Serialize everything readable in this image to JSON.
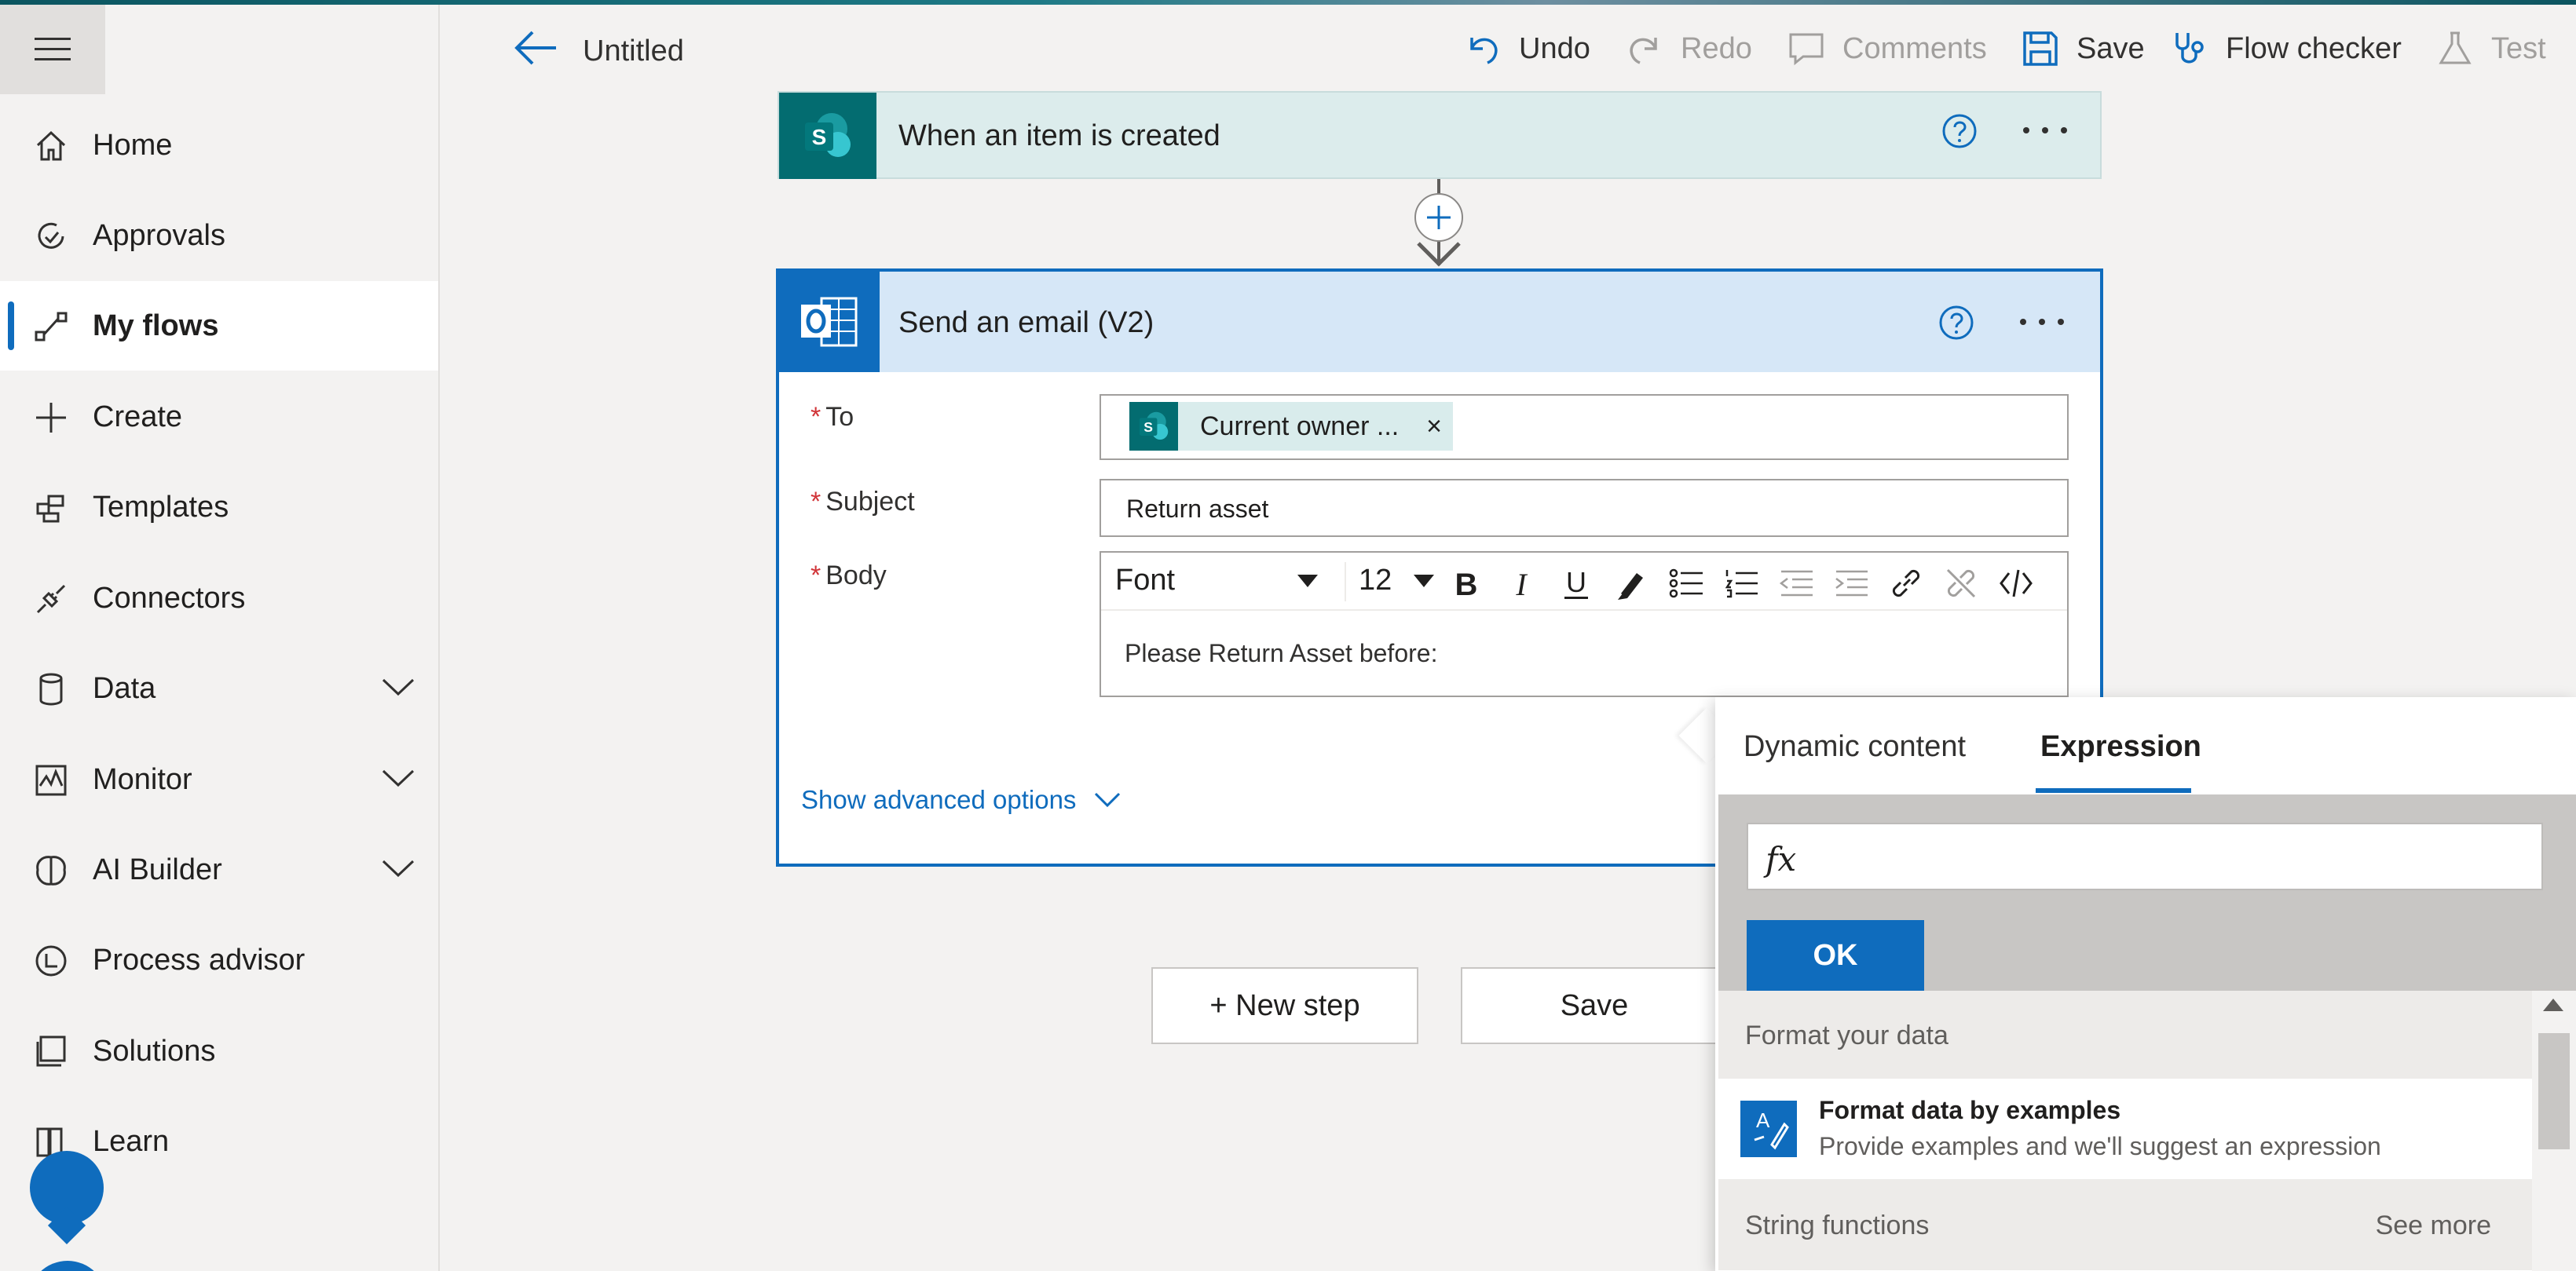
{
  "header": {
    "title": "Untitled",
    "actions": {
      "undo": "Undo",
      "redo": "Redo",
      "comments": "Comments",
      "save": "Save",
      "flow_checker": "Flow checker",
      "test": "Test"
    }
  },
  "sidebar": {
    "items": [
      {
        "label": "Home",
        "icon": "home-icon"
      },
      {
        "label": "Approvals",
        "icon": "approvals-icon"
      },
      {
        "label": "My flows",
        "icon": "flows-icon",
        "active": true
      },
      {
        "label": "Create",
        "icon": "plus-icon"
      },
      {
        "label": "Templates",
        "icon": "templates-icon"
      },
      {
        "label": "Connectors",
        "icon": "connectors-icon"
      },
      {
        "label": "Data",
        "icon": "database-icon",
        "expandable": true
      },
      {
        "label": "Monitor",
        "icon": "monitor-icon",
        "expandable": true
      },
      {
        "label": "AI Builder",
        "icon": "brain-icon",
        "expandable": true
      },
      {
        "label": "Process advisor",
        "icon": "process-advisor-icon"
      },
      {
        "label": "Solutions",
        "icon": "solutions-icon"
      },
      {
        "label": "Learn",
        "icon": "book-icon"
      }
    ]
  },
  "trigger": {
    "title": "When an item is created",
    "icon_letter": "S"
  },
  "email_action": {
    "title": "Send an email (V2)",
    "to_label": "To",
    "to_token": "Current owner ...",
    "token_remove": "×",
    "subject_label": "Subject",
    "subject_value": "Return asset",
    "body_label": "Body",
    "font_name": "Font",
    "font_size": "12",
    "body_text": "Please Return Asset before:",
    "advanced_link": "Show advanced options",
    "required_mark": "*"
  },
  "bottom": {
    "new_step": "+ New step",
    "save": "Save"
  },
  "panel": {
    "tab_dynamic": "Dynamic content",
    "tab_expression": "Expression",
    "fx_label": "fx",
    "ok": "OK",
    "section_format": "Format your data",
    "format_title": "Format data by examples",
    "format_sub": "Provide examples and we'll suggest an expression",
    "section_string": "String functions",
    "see_more": "See more"
  },
  "colors": {
    "accent": "#0f6cbd",
    "sharepoint": "#036c70",
    "required": "#d13438"
  }
}
